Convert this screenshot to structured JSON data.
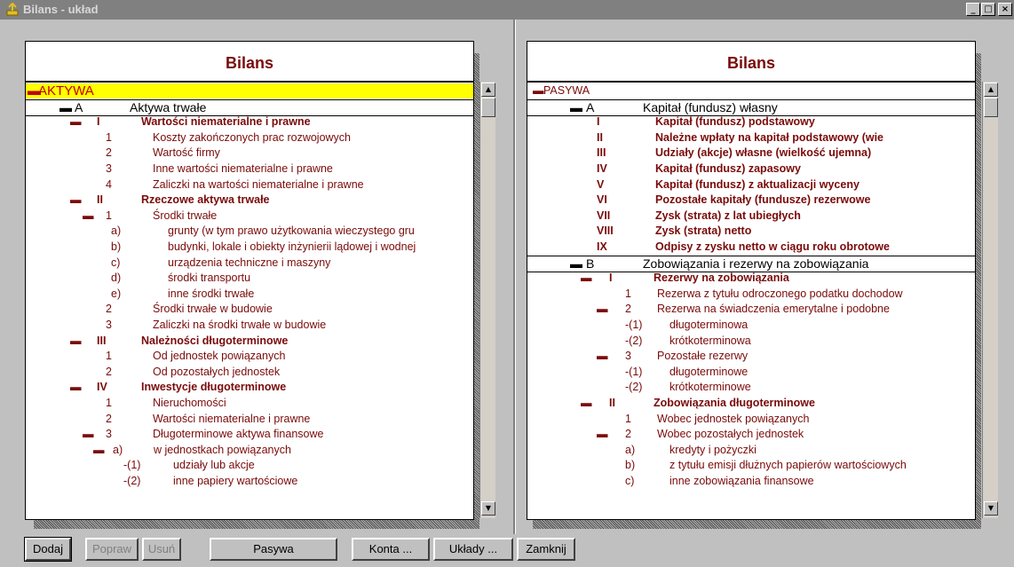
{
  "window": {
    "title": "Bilans - układ",
    "buttons": [
      "_",
      "□",
      "×"
    ]
  },
  "left": {
    "title": "Bilans",
    "rows": [
      {
        "m": "▬",
        "c1": "AKTYWA",
        "style": "sel"
      },
      {
        "m": "▬",
        "c1": "A",
        "c2": "Aktywa trwałe",
        "style": "black sect"
      },
      {
        "m": "▬",
        "c1": "I",
        "c2": "Wartości niematerialne i prawne",
        "style": "bold"
      },
      {
        "c1": "1",
        "c2": "Koszty zakończonych prac rozwojowych",
        "style": "n"
      },
      {
        "c1": "2",
        "c2": "Wartość firmy",
        "style": "n"
      },
      {
        "c1": "3",
        "c2": "Inne wartości niematerialne i prawne",
        "style": "n"
      },
      {
        "c1": "4",
        "c2": "Zaliczki na wartości niematerialne i prawne",
        "style": "n"
      },
      {
        "m": "▬",
        "c1": "II",
        "c2": "Rzeczowe aktywa trwałe",
        "style": "bold"
      },
      {
        "m": "▬",
        "c1": "1",
        "c2": "Środki trwałe",
        "style": "n"
      },
      {
        "c1": "a)",
        "c2": "grunty (w tym prawo użytkowania wieczystego gru",
        "style": "sub"
      },
      {
        "c1": "b)",
        "c2": "budynki, lokale i obiekty inżynierii lądowej i wodnej",
        "style": "sub"
      },
      {
        "c1": "c)",
        "c2": "urządzenia techniczne i maszyny",
        "style": "sub"
      },
      {
        "c1": "d)",
        "c2": "środki transportu",
        "style": "sub"
      },
      {
        "c1": "e)",
        "c2": "inne środki trwałe",
        "style": "sub"
      },
      {
        "c1": "2",
        "c2": "Środki trwałe w budowie",
        "style": "n"
      },
      {
        "c1": "3",
        "c2": "Zaliczki na środki trwałe w budowie",
        "style": "n"
      },
      {
        "m": "▬",
        "c1": "III",
        "c2": "Należności długoterminowe",
        "style": "bold"
      },
      {
        "c1": "1",
        "c2": "Od jednostek powiązanych",
        "style": "n"
      },
      {
        "c1": "2",
        "c2": "Od pozostałych jednostek",
        "style": "n"
      },
      {
        "m": "▬",
        "c1": "IV",
        "c2": "Inwestycje długoterminowe",
        "style": "bold"
      },
      {
        "c1": "1",
        "c2": "Nieruchomości",
        "style": "n"
      },
      {
        "c1": "2",
        "c2": "Wartości niematerialne i prawne",
        "style": "n"
      },
      {
        "m": "▬",
        "c1": "3",
        "c2": "Długoterminowe aktywa finansowe",
        "style": "n"
      },
      {
        "m": "▬",
        "c1": "a)",
        "c2": "w jednostkach powiązanych",
        "style": "sub2"
      },
      {
        "c1": "-(1)",
        "c2": "udziały lub akcje",
        "style": "sub3"
      },
      {
        "c1": "-(2)",
        "c2": "inne papiery wartościowe",
        "style": "sub3"
      }
    ]
  },
  "right": {
    "title": "Bilans",
    "rows": [
      {
        "m": "▬",
        "c1": "PASYWA",
        "style": "top"
      },
      {
        "m": "▬",
        "c1": "A",
        "c2": "Kapitał (fundusz) własny",
        "style": "black sect"
      },
      {
        "c1": "I",
        "c2": "Kapitał (fundusz) podstawowy",
        "style": "bold"
      },
      {
        "c1": "II",
        "c2": "Należne wpłaty na kapitał podstawowy (wie",
        "style": "bold"
      },
      {
        "c1": "III",
        "c2": "Udziały (akcje) własne (wielkość ujemna)",
        "style": "bold"
      },
      {
        "c1": "IV",
        "c2": "Kapitał (fundusz) zapasowy",
        "style": "bold"
      },
      {
        "c1": "V",
        "c2": "Kapitał (fundusz) z aktualizacji wyceny",
        "style": "bold"
      },
      {
        "c1": "VI",
        "c2": "Pozostałe kapitały (fundusze) rezerwowe",
        "style": "bold"
      },
      {
        "c1": "VII",
        "c2": "Zysk (strata) z lat ubiegłych",
        "style": "bold"
      },
      {
        "c1": "VIII",
        "c2": "Zysk (strata) netto",
        "style": "bold"
      },
      {
        "c1": "IX",
        "c2": "Odpisy z zysku netto w ciągu roku obrotowe",
        "style": "bold"
      },
      {
        "m": "▬",
        "c1": "B",
        "c2": "Zobowiązania i rezerwy na zobowiązania",
        "style": "black sect"
      },
      {
        "m": "▬",
        "c1": "I",
        "c2": "Rezerwy na zobowiązania",
        "style": "bold2"
      },
      {
        "c1": "1",
        "c2": "Rezerwa z tytułu odroczonego podatku dochodow",
        "style": "n"
      },
      {
        "m": "▬",
        "c1": "2",
        "c2": "Rezerwa na świadczenia emerytalne i podobne",
        "style": "n"
      },
      {
        "c1": "-(1)",
        "c2": "długoterminowa",
        "style": "sub"
      },
      {
        "c1": "-(2)",
        "c2": "krótkoterminowa",
        "style": "sub"
      },
      {
        "m": "▬",
        "c1": "3",
        "c2": "Pozostałe rezerwy",
        "style": "n"
      },
      {
        "c1": "-(1)",
        "c2": "długoterminowe",
        "style": "sub"
      },
      {
        "c1": "-(2)",
        "c2": "krótkoterminowe",
        "style": "sub"
      },
      {
        "m": "▬",
        "c1": "II",
        "c2": "Zobowiązania długoterminowe",
        "style": "bold2"
      },
      {
        "c1": "1",
        "c2": "Wobec jednostek powiązanych",
        "style": "n"
      },
      {
        "m": "▬",
        "c1": "2",
        "c2": "Wobec pozostałych jednostek",
        "style": "n"
      },
      {
        "c1": "a)",
        "c2": "kredyty i pożyczki",
        "style": "sub"
      },
      {
        "c1": "b)",
        "c2": "z tytułu emisji dłużnych papierów wartościowych",
        "style": "sub"
      },
      {
        "c1": "c)",
        "c2": "inne zobowiązania finansowe",
        "style": "sub"
      }
    ]
  },
  "buttons": {
    "dodaj": "Dodaj",
    "popraw": "Popraw",
    "usun": "Usuń",
    "pasywa": "Pasywa",
    "konta": "Konta ...",
    "uklady": "Układy ...",
    "zamknij": "Zamknij"
  }
}
